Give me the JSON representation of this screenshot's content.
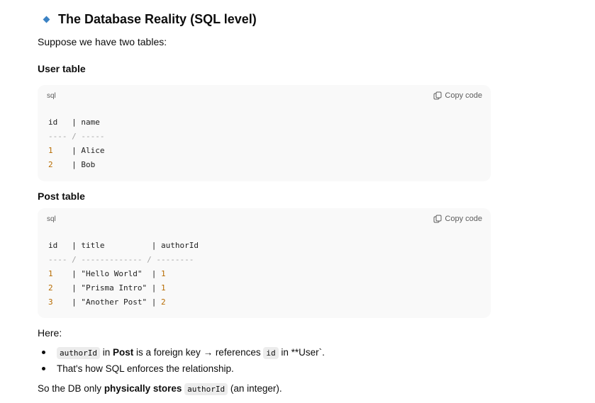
{
  "heading": "The Database Reality (SQL level)",
  "intro": "Suppose we have two tables:",
  "user_table": {
    "title": "User table",
    "lang": "sql",
    "copy_label": "Copy code",
    "header": [
      "id",
      "name"
    ],
    "separator": [
      "----",
      "-----"
    ],
    "rows": [
      [
        "1",
        "Alice"
      ],
      [
        "2",
        "Bob"
      ]
    ]
  },
  "post_table": {
    "title": "Post table",
    "lang": "sql",
    "copy_label": "Copy code",
    "header": [
      "id",
      "title",
      "authorId"
    ],
    "separator": [
      "----",
      "-------------",
      "--------"
    ],
    "rows": [
      [
        "1",
        "\"Hello World\"",
        "1"
      ],
      [
        "2",
        "\"Prisma Intro\"",
        "1"
      ],
      [
        "3",
        "\"Another Post\"",
        "2"
      ]
    ]
  },
  "here_label": "Here:",
  "bullets": {
    "b1_code": "authorId",
    "b1_text1": " in ",
    "b1_bold": "Post",
    "b1_text2": " is a foreign key → references ",
    "b1_code2": "id",
    "b1_text3": " in **User`.",
    "b2_text": "That's how SQL enforces the relationship."
  },
  "conclusion": {
    "text1": "So the DB only ",
    "bold": "physically stores",
    "code": "authorId",
    "text2": " (an integer)."
  },
  "colors": {
    "accent": "#3b82c4",
    "code_bg": "#f9f9f9",
    "number": "#b76b01"
  }
}
